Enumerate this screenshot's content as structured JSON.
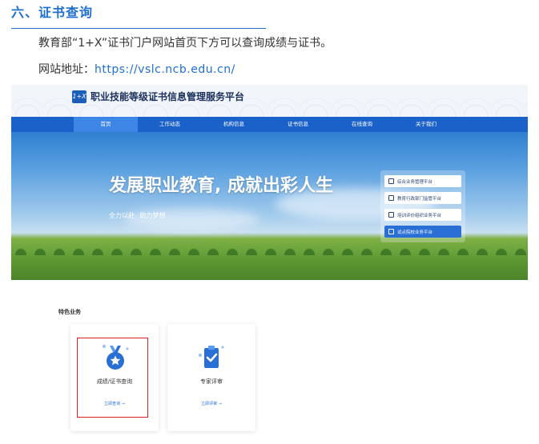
{
  "section": {
    "title": "六、证书查询",
    "paragraph1": "教育部“1+X”证书门户网站首页下方可以查询成绩与证书。",
    "site_label": "网站地址：",
    "site_url": "https://vslc.ncb.edu.cn/"
  },
  "portal": {
    "logo_text": "1+X",
    "brand": "职业技能等级证书信息管理服务平台",
    "nav": [
      "首页",
      "工作动态",
      "机构信息",
      "证书信息",
      "在线查询",
      "关于我们"
    ],
    "nav_active_index": 0,
    "banner_title": "发展职业教育, 成就出彩人生",
    "banner_subtitle": "全力以赴    助力梦想",
    "side_links": [
      "综合业务管理平台",
      "教育行政部门监管平台",
      "培训评价组织业务平台",
      "试点院校业务平台"
    ],
    "side_links_active_index": 3
  },
  "features": {
    "label": "特色业务",
    "cards": [
      {
        "title": "成绩/证书查询",
        "link": "立即查询 →",
        "icon": "medal-icon"
      },
      {
        "title": "专家评审",
        "link": "立即评审 →",
        "icon": "clipboard-check-icon"
      }
    ],
    "highlighted_card_index": 0
  },
  "colors": {
    "accent": "#1f6fd1",
    "nav_bg": "#1a62c9",
    "highlight": "#e02020"
  }
}
